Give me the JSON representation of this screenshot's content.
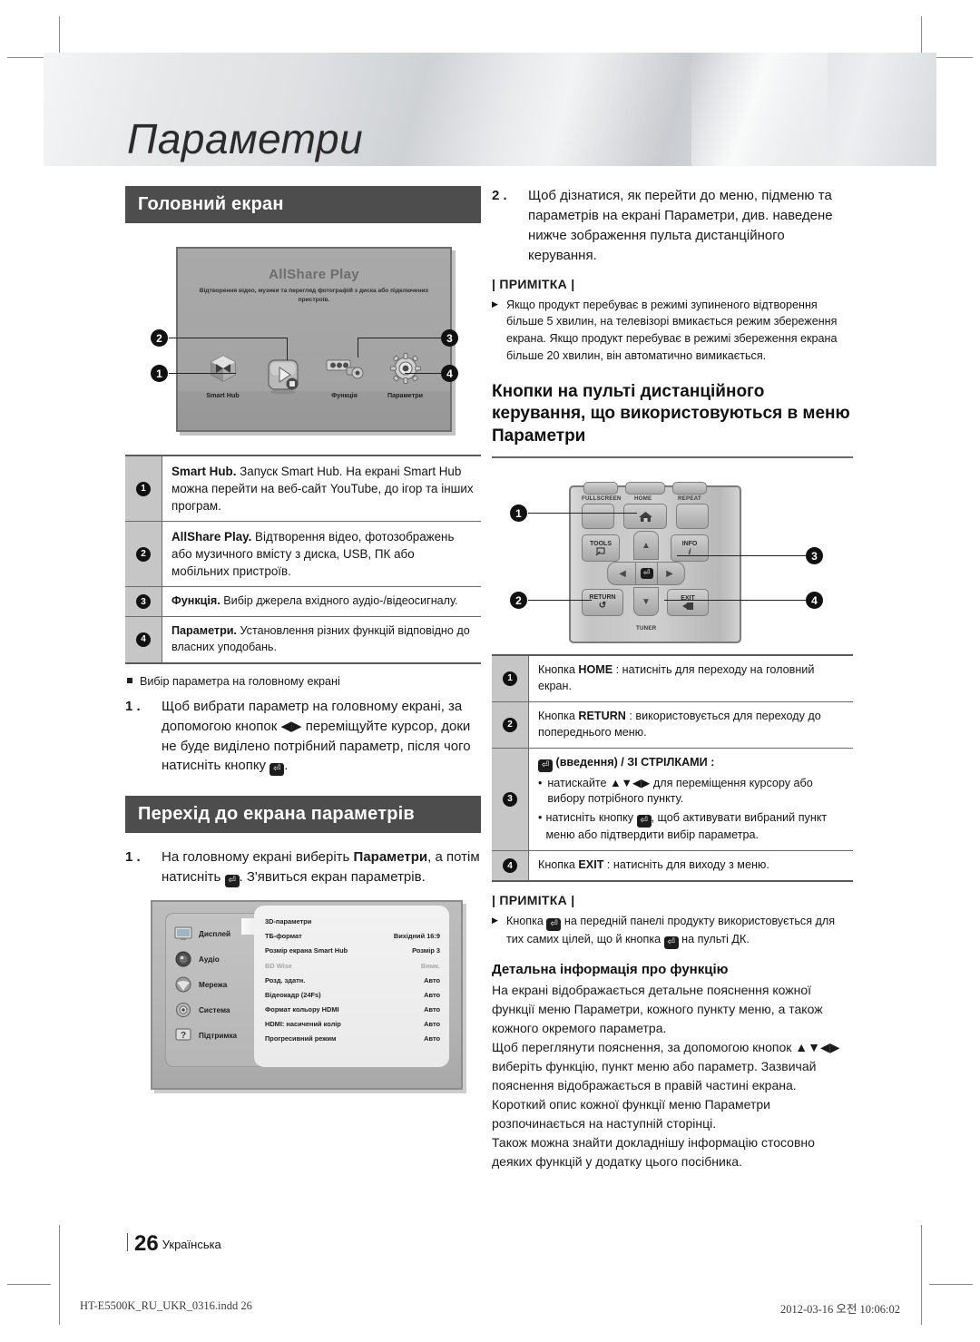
{
  "page": {
    "title": "Параметри",
    "page_number": "26",
    "language_label": "Українська",
    "print_filename": "HT-E5500K_RU_UKR_0316.indd   26",
    "print_timestamp": "2012-03-16   오전 10:06:02"
  },
  "left": {
    "section1_title": "Головний екран",
    "home_screen": {
      "title": "AllShare Play",
      "subtitle": "Відтворення відео, музики та перегляд фотографій з диска або підключених пристроїв.",
      "items": [
        {
          "label": "Smart Hub",
          "icon": "smart-hub-cube-icon"
        },
        {
          "label": "",
          "icon": "allshare-play-icon"
        },
        {
          "label": "Функція",
          "icon": "function-connectors-icon"
        },
        {
          "label": "Параметри",
          "icon": "settings-gear-icon"
        }
      ],
      "callouts": [
        "1",
        "2",
        "3",
        "4"
      ]
    },
    "table": [
      {
        "num": "1",
        "bold": "Smart Hub.",
        "text": " Запуск Smart Hub. На екрані Smart Hub можна перейти на веб-сайт YouTube, до ігор та інших програм."
      },
      {
        "num": "2",
        "bold": "AllShare Play.",
        "text": " Відтворення відео, фотозображень або музичного вмісту з диска, USB, ПК або мобільних пристроїв."
      },
      {
        "num": "3",
        "bold": "Функція.",
        "text": " Вибір джерела вхідного аудіо-/відеосигналу."
      },
      {
        "num": "4",
        "bold": "Параметри.",
        "text": " Установлення різних функцій відповідно до власних уподобань."
      }
    ],
    "bullet": "Вибір параметра на головному екрані",
    "step1_num": "1 .",
    "step1_a": "Щоб вибрати параметр на головному екрані, за допомогою кнопок ",
    "step1_arrows": "◀▶",
    "step1_b": " переміщуйте курсор, доки не буде виділено потрібний параметр, після чого натисніть кнопку ",
    "step1_c": ".",
    "section2_title": "Перехід до екрана параметрів",
    "step2_num": "1 .",
    "step2_a": "На головному екрані виберіть ",
    "step2_bold": "Параметри",
    "step2_b": ", а потім натисніть ",
    "step2_c": ". З'явиться екран параметрів.",
    "settings_screen": {
      "sidebar": [
        {
          "label": "Дисплей",
          "icon": "display-tv-icon"
        },
        {
          "label": "Аудіо",
          "icon": "audio-speaker-icon"
        },
        {
          "label": "Мережа",
          "icon": "network-globe-icon"
        },
        {
          "label": "Система",
          "icon": "system-gear-icon"
        },
        {
          "label": "Підтримка",
          "icon": "support-question-icon"
        }
      ],
      "rows": [
        {
          "label": "3D-параметри",
          "value": "",
          "dim": false
        },
        {
          "label": "ТБ-формат",
          "value": "Вихідний 16:9",
          "dim": false
        },
        {
          "label": "Розмір екрана Smart Hub",
          "value": "Розмір 3",
          "dim": false
        },
        {
          "label": "BD Wise",
          "value": "Вимк.",
          "dim": true
        },
        {
          "label": "Розд. здатн.",
          "value": "Авто",
          "dim": false
        },
        {
          "label": "Відеокадр (24Fs)",
          "value": "Авто",
          "dim": false
        },
        {
          "label": "Формат кольору HDMI",
          "value": "Авто",
          "dim": false
        },
        {
          "label": "HDMI: насичений колір",
          "value": "Авто",
          "dim": false
        },
        {
          "label": "Прогресивний режим",
          "value": "Авто",
          "dim": false
        }
      ]
    }
  },
  "right": {
    "step2_num": "2 .",
    "step2_text": "Щоб дізнатися, як перейти до меню, підменю та параметрів на екрані Параметри, див. наведене нижче зображення пульта дистанційного керування.",
    "note1_title": "| ПРИМІТКА |",
    "note1_text": "Якщо продукт перебуває в режимі зупиненого відтворення більше 5 хвилин, на телевізорі вмикається режим збереження екрана. Якщо продукт перебуває в режимі збереження екрана більше 20 хвилин, він автоматично вимикається.",
    "heading": "Кнопки на пульті дистанційного керування, що використовуються в меню Параметри",
    "remote": {
      "labels": {
        "fullscreen": "FULLSCREEN",
        "home": "HOME",
        "repeat": "REPEAT",
        "tools": "TOOLS",
        "info": "INFO",
        "return": "RETURN",
        "exit": "EXIT",
        "tuner": "TUNER"
      },
      "callouts": [
        "1",
        "2",
        "3",
        "4"
      ]
    },
    "table": [
      {
        "num": "1",
        "pre": "Кнопка ",
        "bold": "HOME",
        "post": " : натисніть для переходу на головний екран."
      },
      {
        "num": "2",
        "pre": "Кнопка ",
        "bold": "RETURN",
        "post": " : використовується для переходу до попереднього меню."
      },
      {
        "num": "4",
        "pre": "Кнопка ",
        "bold": "EXIT",
        "post": " : натисніть для виходу з меню."
      }
    ],
    "row3": {
      "num": "3",
      "header_a": "(введення) / ",
      "header_b": "ЗІ СТРІЛКАМИ",
      "header_c": " :",
      "bullet1_a": "натискайте ",
      "bullet1_arrows": "▲▼◀▶",
      "bullet1_b": " для переміщення курсору або вибору потрібного пункту.",
      "bullet2_a": "натисніть кнопку ",
      "bullet2_b": ", щоб активувати вибраний пункт меню або підтвердити вибір параметра."
    },
    "note2_title": "| ПРИМІТКА |",
    "note2_a": "Кнопка ",
    "note2_b": " на передній панелі продукту використовується для тих самих цілей, що й кнопка ",
    "note2_c": " на пульті ДК.",
    "detail_heading": "Детальна інформація про функцію",
    "detail_p1": "На екрані відображається детальне пояснення кожної функції меню Параметри, кожного пункту меню, а також кожного окремого параметра.",
    "detail_p2_a": "Щоб переглянути пояснення, за допомогою кнопок ",
    "detail_p2_arrows": "▲▼◀▶",
    "detail_p2_b": " виберіть функцію, пункт меню або параметр. Зазвичай пояснення відображається в правій частині екрана. Короткий опис кожної функції меню Параметри розпочинається на наступній сторінці.",
    "detail_p3": "Також можна знайти докладнішу інформацію стосовно деяких функцій у додатку цього посібника."
  },
  "colors": {
    "section_bar": "#4d4d4d",
    "badge": "#111111",
    "rule": "#6a6a6a"
  }
}
